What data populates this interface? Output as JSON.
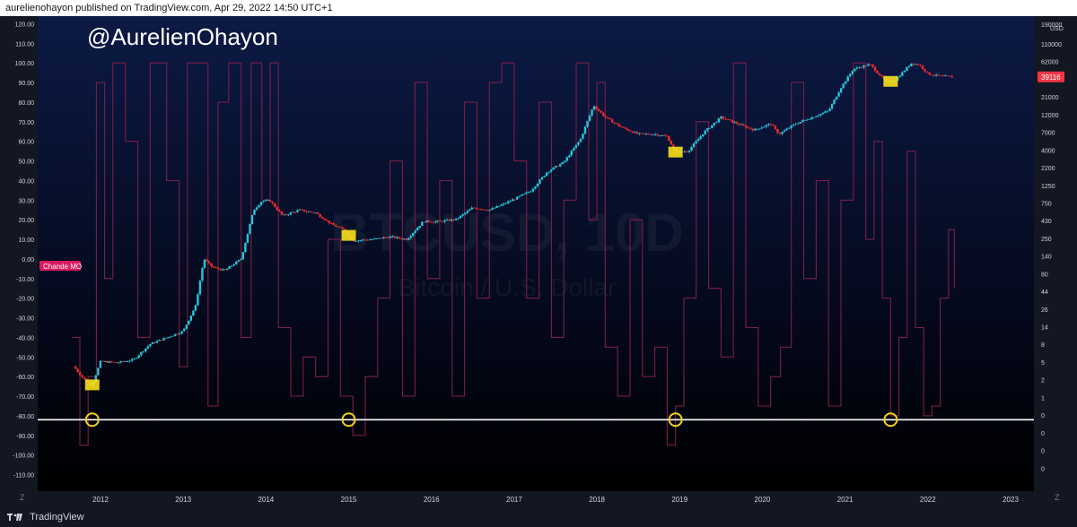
{
  "header": {
    "published_by": "aurelienohayon published on TradingView.com, Apr 29, 2022 14:50 UTC+1"
  },
  "watermark": {
    "handle": "@AurelienOhayon",
    "symbol": "BTCUSD, 10D",
    "description": "Bitcoin / U.S. Dollar"
  },
  "indicator": {
    "label": "Chande MO",
    "threshold": -82
  },
  "price_tag": {
    "value": "39116",
    "color": "#f23645"
  },
  "footer": {
    "brand": "TradingView",
    "zoom_left": "Z",
    "zoom_right": "Z"
  },
  "colors": {
    "background_top": "#0c1a45",
    "background_bottom": "#000000",
    "candle_up": "#26c6da",
    "candle_down": "#ef2b2b",
    "cmo_line": "#7a1f48",
    "marker_circle": "#f2d21b",
    "marker_box": "#f7e01b",
    "threshold_line": "#ffffff"
  },
  "chart_data": {
    "type": "line",
    "title": "",
    "xlabel": "",
    "ylabel": "",
    "x_ticks": [
      "2012",
      "2013",
      "2014",
      "2015",
      "2016",
      "2017",
      "2018",
      "2019",
      "2020",
      "2021",
      "2022",
      "2023"
    ],
    "left_axis": {
      "ticks": [
        "120.00",
        "110.00",
        "100.00",
        "90.00",
        "80.00",
        "70.00",
        "60.00",
        "50.00",
        "40.00",
        "30.00",
        "20.00",
        "10.00",
        "0.00",
        "-10.00",
        "-20.00",
        "-30.00",
        "-40.00",
        "-50.00",
        "-60.00",
        "-70.00",
        "-80.00",
        "-90.00",
        "-100.00",
        "-110.00"
      ],
      "range": [
        -117,
        124
      ]
    },
    "right_axis": {
      "unit": "USD",
      "scale": "log",
      "ticks": [
        "190000",
        "110000",
        "62000",
        "36000",
        "21000",
        "12000",
        "7000",
        "4000",
        "2200",
        "1250",
        "750",
        "430",
        "250",
        "140",
        "80",
        "44",
        "26",
        "14",
        "8",
        "5",
        "2",
        "1",
        "0",
        "0",
        "0",
        "0"
      ]
    },
    "series": [
      {
        "name": "BTCUSD",
        "style": "candles",
        "x": [
          2011.67,
          2011.8,
          2011.9,
          2012.0,
          2012.2,
          2012.4,
          2012.6,
          2012.8,
          2013.0,
          2013.15,
          2013.25,
          2013.35,
          2013.5,
          2013.7,
          2013.85,
          2013.95,
          2014.05,
          2014.2,
          2014.4,
          2014.6,
          2014.8,
          2014.95,
          2015.05,
          2015.3,
          2015.5,
          2015.7,
          2015.9,
          2016.1,
          2016.3,
          2016.5,
          2016.7,
          2016.9,
          2017.05,
          2017.2,
          2017.4,
          2017.6,
          2017.8,
          2017.96,
          2018.1,
          2018.3,
          2018.5,
          2018.7,
          2018.85,
          2018.95,
          2019.1,
          2019.3,
          2019.5,
          2019.7,
          2019.9,
          2020.1,
          2020.2,
          2020.4,
          2020.6,
          2020.8,
          2020.95,
          2021.1,
          2021.3,
          2021.5,
          2021.6,
          2021.8,
          2021.9,
          2022.0,
          2022.15,
          2022.3
        ],
        "values": [
          4.5,
          3.0,
          2.5,
          5.2,
          5.0,
          5.5,
          9.0,
          11.0,
          13.5,
          30.0,
          130.0,
          100.0,
          90.0,
          130.0,
          600.0,
          800.0,
          800.0,
          500.0,
          600.0,
          550.0,
          380.0,
          320.0,
          230.0,
          240.0,
          260.0,
          240.0,
          420.0,
          420.0,
          450.0,
          650.0,
          600.0,
          750.0,
          900.0,
          1100.0,
          2000.0,
          2700.0,
          5500.0,
          16000.0,
          11000.0,
          8000.0,
          6500.0,
          6500.0,
          6000.0,
          3700.0,
          3800.0,
          7000.0,
          11000.0,
          9000.0,
          7400.0,
          9000.0,
          6500.0,
          9000.0,
          11000.0,
          13500.0,
          28000.0,
          50000.0,
          58000.0,
          33000.0,
          35000.0,
          60000.0,
          57000.0,
          43000.0,
          40000.0,
          39116.0
        ]
      },
      {
        "name": "Chande MO",
        "style": "line",
        "x": [
          2011.65,
          2011.75,
          2011.85,
          2011.95,
          2012.05,
          2012.15,
          2012.3,
          2012.45,
          2012.6,
          2012.8,
          2012.95,
          2013.05,
          2013.2,
          2013.3,
          2013.42,
          2013.55,
          2013.7,
          2013.82,
          2013.95,
          2014.05,
          2014.15,
          2014.3,
          2014.45,
          2014.6,
          2014.75,
          2014.9,
          2015.05,
          2015.2,
          2015.35,
          2015.5,
          2015.65,
          2015.8,
          2015.95,
          2016.1,
          2016.25,
          2016.4,
          2016.55,
          2016.7,
          2016.85,
          2017.0,
          2017.15,
          2017.3,
          2017.45,
          2017.6,
          2017.75,
          2017.9,
          2018.0,
          2018.1,
          2018.25,
          2018.4,
          2018.55,
          2018.7,
          2018.85,
          2018.95,
          2019.05,
          2019.2,
          2019.35,
          2019.5,
          2019.65,
          2019.8,
          2019.95,
          2020.1,
          2020.22,
          2020.35,
          2020.5,
          2020.65,
          2020.8,
          2020.95,
          2021.1,
          2021.25,
          2021.35,
          2021.45,
          2021.55,
          2021.65,
          2021.75,
          2021.85,
          2021.95,
          2022.05,
          2022.15,
          2022.25,
          2022.32
        ],
        "values": [
          -40,
          -95,
          -60,
          90,
          -10,
          100,
          60,
          -40,
          100,
          40,
          -55,
          100,
          100,
          -75,
          80,
          100,
          -40,
          100,
          30,
          100,
          -35,
          -70,
          -50,
          -60,
          10,
          -70,
          -90,
          -60,
          -20,
          50,
          -70,
          90,
          -10,
          40,
          -70,
          80,
          -20,
          90,
          100,
          50,
          -20,
          80,
          -40,
          30,
          100,
          20,
          90,
          -45,
          -70,
          20,
          -60,
          -45,
          -95,
          -75,
          -20,
          70,
          -15,
          -50,
          100,
          -35,
          -75,
          -60,
          -45,
          90,
          -10,
          40,
          -75,
          30,
          100,
          10,
          60,
          -20,
          -80,
          -40,
          55,
          -35,
          -80,
          -75,
          -20,
          15,
          -15
        ]
      }
    ],
    "highlights": [
      2011.9,
      2015.0,
      2018.95,
      2021.55
    ],
    "grid": false,
    "legend": "none"
  }
}
